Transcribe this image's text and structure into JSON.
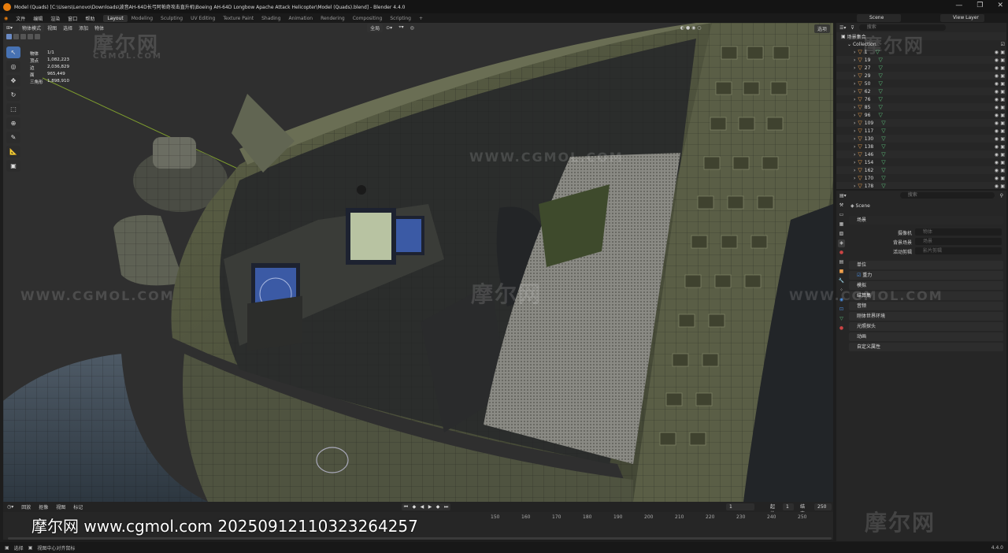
{
  "window": {
    "title": "Model (Quads) [C:\\Users\\Lenovo\\Downloads\\波音AH-64D长弓阿帕奇攻击直升机\\Boeing AH-64D Longbow Apache Attack Helicopter\\Model (Quads).blend] - Blender 4.4.0",
    "controls": [
      "—",
      "❐",
      "✕"
    ]
  },
  "menubar": {
    "items": [
      "文件",
      "编辑",
      "渲染",
      "窗口",
      "帮助"
    ],
    "workspaces": [
      "Layout",
      "Modeling",
      "Sculpting",
      "UV Editing",
      "Texture Paint",
      "Shading",
      "Animation",
      "Rendering",
      "Compositing",
      "Scripting"
    ],
    "active_workspace": "Layout",
    "add_tab": "+",
    "scene": "Scene",
    "view_layer": "View Layer"
  },
  "viewport": {
    "mode": "物体模式",
    "menus": [
      "视图",
      "选择",
      "添加",
      "物体"
    ],
    "transform_orientation": "全局",
    "options": "选项",
    "stats": [
      {
        "label": "物体",
        "value": "1/1"
      },
      {
        "label": "顶点",
        "value": "1,082,223"
      },
      {
        "label": "边",
        "value": "2,036,829"
      },
      {
        "label": "面",
        "value": "965,449"
      },
      {
        "label": "三角形",
        "value": "1,898,910"
      }
    ],
    "tools": [
      "select",
      "cursor",
      "move",
      "rotate",
      "scale",
      "transform",
      "annotate",
      "measure",
      "add-cube"
    ],
    "watermarks": [
      "摩尔网",
      "CGMOL.COM",
      "WWW.CGMOL.COM"
    ]
  },
  "timeline": {
    "menus": [
      "回放",
      "抠像",
      "视图",
      "标记"
    ],
    "current_frame": "1",
    "start_label": "起始",
    "start": "1",
    "end_label": "结束",
    "end": "250",
    "ticks": [
      "150",
      "160",
      "170",
      "180",
      "190",
      "200",
      "210",
      "220",
      "230",
      "240",
      "250"
    ]
  },
  "overlay_text": "摩尔网 www.cgmol.com 20250912110323264257",
  "statusbar": {
    "select": "选择",
    "center": "视图中心对齐鼠标",
    "version": "4.4.0"
  },
  "outliner": {
    "search_placeholder": "搜索",
    "scene_collection": "场景集合",
    "collection": "Collection",
    "items": [
      "1",
      "19",
      "27",
      "29",
      "50",
      "62",
      "76",
      "85",
      "96",
      "109",
      "117",
      "130",
      "138",
      "146",
      "154",
      "162",
      "170",
      "178"
    ]
  },
  "properties": {
    "search_placeholder": "搜索",
    "scene_name": "Scene",
    "section_scene": "场景",
    "camera_label": "摄像机",
    "camera_placeholder": "物体",
    "bg_scene_label": "背景场景",
    "bg_scene_placeholder": "场景",
    "active_clip_label": "活动剪辑",
    "active_clip_placeholder": "影片剪辑",
    "sections": [
      "单位",
      "重力",
      "模拟",
      "结算集",
      "音频",
      "刚体世界环境",
      "光照探头",
      "动画",
      "自定义属性"
    ]
  },
  "colors": {
    "accent": "#4772b3",
    "object_orange": "#f0a04b",
    "mesh_green": "#5dc47d",
    "blender_logo": "#e87d0d"
  }
}
